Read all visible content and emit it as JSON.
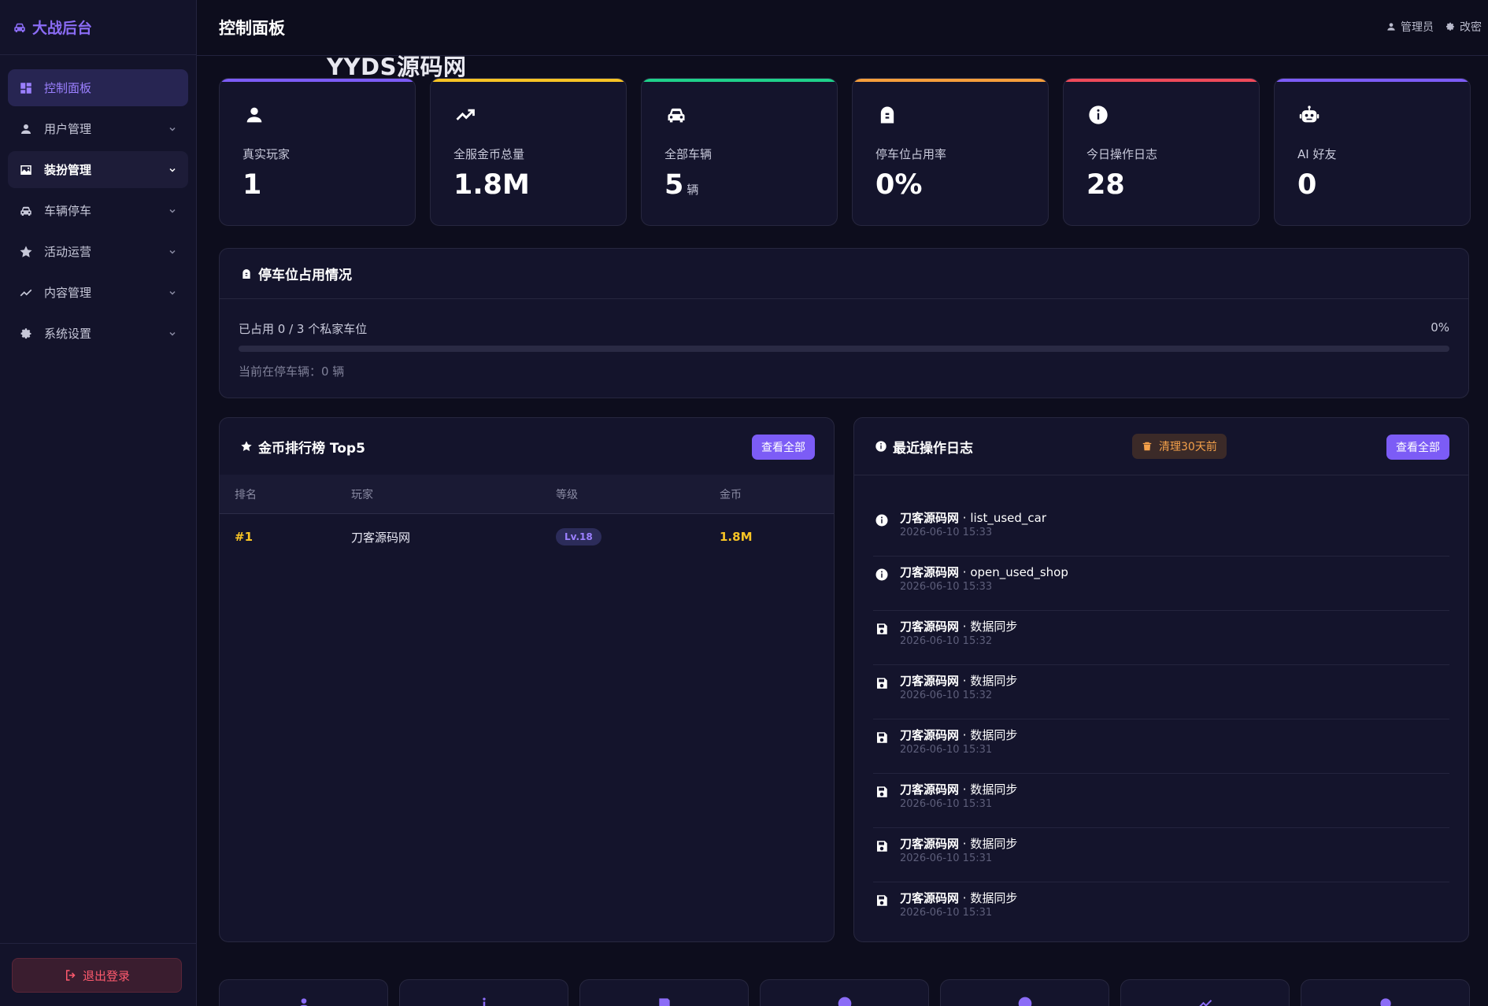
{
  "brand": {
    "title": "大战后台"
  },
  "sidebar": {
    "items": [
      {
        "label": "控制面板",
        "icon": "dashboard-icon"
      },
      {
        "label": "用户管理",
        "icon": "user-icon"
      },
      {
        "label": "装扮管理",
        "icon": "image-icon"
      },
      {
        "label": "车辆停车",
        "icon": "car-icon"
      },
      {
        "label": "活动运营",
        "icon": "star-icon"
      },
      {
        "label": "内容管理",
        "icon": "trend-icon"
      },
      {
        "label": "系统设置",
        "icon": "gear-icon"
      }
    ],
    "logout_label": "退出登录"
  },
  "header": {
    "title": "控制面板",
    "user_label": "管理员",
    "settings_label": "改密"
  },
  "watermark": "YYDS源码网",
  "stats": [
    {
      "label": "真实玩家",
      "value": "1",
      "unit": "",
      "accent": "#7c5cf6",
      "icon": "user-icon"
    },
    {
      "label": "全服金币总量",
      "value": "1.8M",
      "unit": "",
      "accent": "#f7c325",
      "icon": "trend-icon"
    },
    {
      "label": "全部车辆",
      "value": "5",
      "unit": "辆",
      "accent": "#1fd18a",
      "icon": "car-icon"
    },
    {
      "label": "停车位占用率",
      "value": "0%",
      "unit": "",
      "accent": "#f59e3c",
      "icon": "parking-icon"
    },
    {
      "label": "今日操作日志",
      "value": "28",
      "unit": "",
      "accent": "#ef4a5a",
      "icon": "info-icon"
    },
    {
      "label": "AI 好友",
      "value": "0",
      "unit": "",
      "accent": "#7c5cf6",
      "icon": "robot-icon"
    }
  ],
  "parking": {
    "title": "停车位占用情况",
    "occupied_text": "已占用 0 / 3 个私家车位",
    "percent_text": "0%",
    "progress": 0,
    "note": "当前在停车辆：0 辆"
  },
  "leaderboard": {
    "title": "金币排行榜 Top5",
    "view_all": "查看全部",
    "columns": [
      "排名",
      "玩家",
      "等级",
      "金币"
    ],
    "rows": [
      {
        "rank": "#1",
        "player": "刀客源码网",
        "level": "Lv.18",
        "coins": "1.8M"
      }
    ]
  },
  "logs": {
    "title": "最近操作日志",
    "clear_label": "清理30天前",
    "view_all": "查看全部",
    "items": [
      {
        "user": "刀客源码网",
        "action": " · list_used_car",
        "time": "2026-06-10 15:33",
        "icon": "info-icon"
      },
      {
        "user": "刀客源码网",
        "action": " · open_used_shop",
        "time": "2026-06-10 15:33",
        "icon": "info-icon"
      },
      {
        "user": "刀客源码网",
        "action": " · 数据同步",
        "time": "2026-06-10 15:32",
        "icon": "save-icon"
      },
      {
        "user": "刀客源码网",
        "action": " · 数据同步",
        "time": "2026-06-10 15:32",
        "icon": "save-icon"
      },
      {
        "user": "刀客源码网",
        "action": " · 数据同步",
        "time": "2026-06-10 15:31",
        "icon": "save-icon"
      },
      {
        "user": "刀客源码网",
        "action": " · 数据同步",
        "time": "2026-06-10 15:31",
        "icon": "save-icon"
      },
      {
        "user": "刀客源码网",
        "action": " · 数据同步",
        "time": "2026-06-10 15:31",
        "icon": "save-icon"
      },
      {
        "user": "刀客源码网",
        "action": " · 数据同步",
        "time": "2026-06-10 15:31",
        "icon": "save-icon"
      }
    ]
  },
  "quick_cards": [
    {
      "icon": "user-icon"
    },
    {
      "icon": "info-icon"
    },
    {
      "icon": "save-icon"
    },
    {
      "icon": "circle-icon"
    },
    {
      "icon": "circle-icon"
    },
    {
      "icon": "trend-icon"
    },
    {
      "icon": "gear-icon"
    }
  ]
}
